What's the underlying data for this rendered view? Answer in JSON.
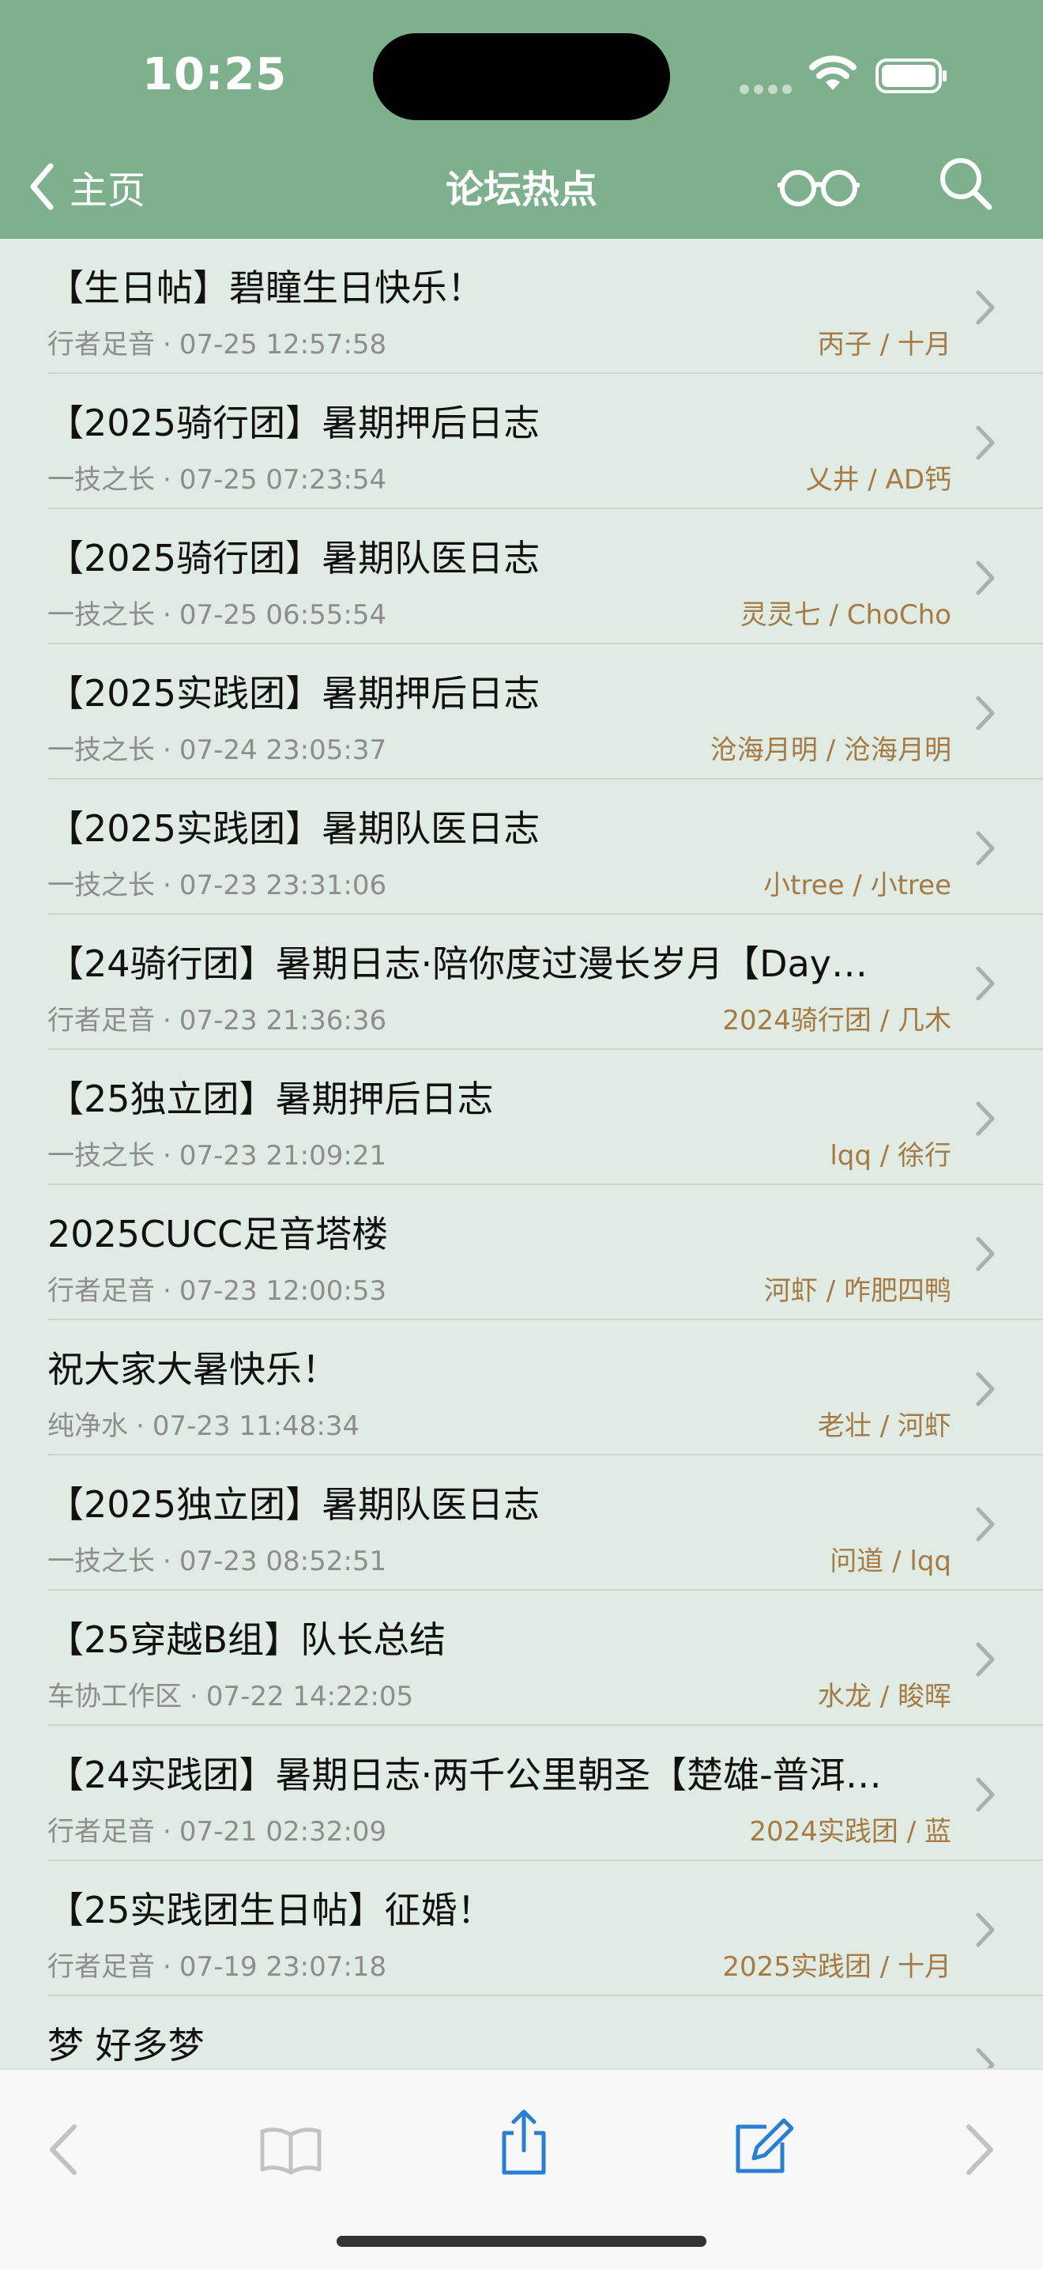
{
  "status_bar": {
    "time": "10:25"
  },
  "nav": {
    "back_label": "主页",
    "title": "论坛热点"
  },
  "topics": [
    {
      "title": "【生日帖】碧瞳生日快乐！",
      "board": "行者足音",
      "time": "07-25 12:57:58",
      "authors": "丙子 / 十月"
    },
    {
      "title": "【2025骑行团】暑期押后日志",
      "board": "一技之长",
      "time": "07-25 07:23:54",
      "authors": "乂井 / AD钙"
    },
    {
      "title": "【2025骑行团】暑期队医日志",
      "board": "一技之长",
      "time": "07-25 06:55:54",
      "authors": "灵灵七 / ChoCho"
    },
    {
      "title": "【2025实践团】暑期押后日志",
      "board": "一技之长",
      "time": "07-24 23:05:37",
      "authors": "沧海月明 / 沧海月明"
    },
    {
      "title": "【2025实践团】暑期队医日志",
      "board": "一技之长",
      "time": "07-23 23:31:06",
      "authors": "小tree / 小tree"
    },
    {
      "title": "【24骑行团】暑期日志·陪你度过漫长岁月【Day…",
      "board": "行者足音",
      "time": "07-23 21:36:36",
      "authors": "2024骑行团 / 几木"
    },
    {
      "title": "【25独立团】暑期押后日志",
      "board": "一技之长",
      "time": "07-23 21:09:21",
      "authors": "lqq / 徐行"
    },
    {
      "title": "2025CUCC足音塔楼",
      "board": "行者足音",
      "time": "07-23 12:00:53",
      "authors": "河虾 / 咋肥四鸭"
    },
    {
      "title": "祝大家大暑快乐！",
      "board": "纯净水",
      "time": "07-23 11:48:34",
      "authors": "老壮 / 河虾"
    },
    {
      "title": "【2025独立团】暑期队医日志",
      "board": "一技之长",
      "time": "07-23 08:52:51",
      "authors": "问道 / lqq"
    },
    {
      "title": "【25穿越B组】队长总结",
      "board": "车协工作区",
      "time": "07-22 14:22:05",
      "authors": "水龙 / 睃晖"
    },
    {
      "title": "【24实践团】暑期日志·两千公里朝圣【楚雄-普洱…",
      "board": "行者足音",
      "time": "07-21 02:32:09",
      "authors": "2024实践团 / 蓝"
    },
    {
      "title": "【25实践团生日帖】征婚！",
      "board": "行者足音",
      "time": "07-19 23:07:18",
      "authors": "2025实践团 / 十月"
    },
    {
      "title": "梦 好多梦",
      "board": "",
      "time": "",
      "authors": ""
    }
  ],
  "meta_separator": "·",
  "toolbar": {
    "icons": [
      "back-arrow-icon",
      "book-icon",
      "share-icon",
      "compose-icon",
      "forward-arrow-icon"
    ]
  },
  "colors": {
    "header": "#7fb08e",
    "list_bg": "#e0ece3",
    "author": "#a57a45",
    "meta": "#8d8d8d",
    "accent": "#2a7fd4"
  }
}
